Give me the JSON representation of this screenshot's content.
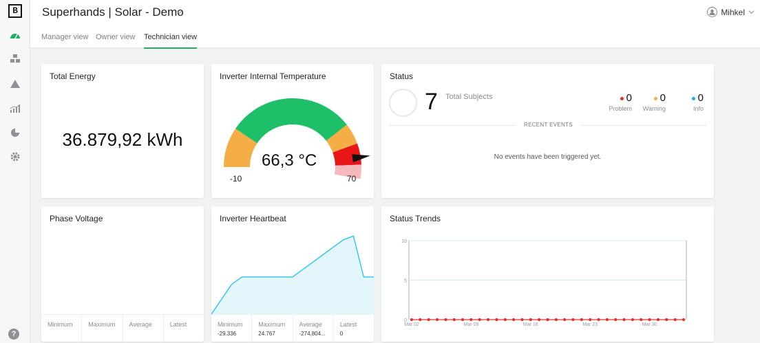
{
  "app": {
    "logo": "B",
    "title": "Superhands | Solar - Demo"
  },
  "user": {
    "name": "Mihkel"
  },
  "nav": {
    "tabs": [
      {
        "label": "Manager view",
        "active": false
      },
      {
        "label": "Owner view",
        "active": false
      },
      {
        "label": "Technician view",
        "active": true
      }
    ],
    "rail_icons": [
      "dashboard-icon",
      "devices-icon",
      "alerts-icon",
      "analytics-icon",
      "reports-icon",
      "settings-icon"
    ],
    "help": "?"
  },
  "colors": {
    "accent": "#1fb05f",
    "gauge_green": "#1fbe68",
    "gauge_orange": "#f5ad45",
    "gauge_red": "#e81616",
    "gauge_pink": "#f6b9bb",
    "problem": "#e82c2c",
    "warning": "#f5ad45",
    "info": "#1fa9e6",
    "heartbeat_fill": "#e3f6fc",
    "heartbeat_line": "#2cc4ea",
    "trend_marker": "#e82c2c"
  },
  "widgets": {
    "total_energy": {
      "title": "Total Energy",
      "value": "36.879,92 kWh"
    },
    "inverter_temp": {
      "title": "Inverter Internal Temperature",
      "value": "66,3 °C",
      "min": "-10",
      "max": "70",
      "reading": 66.3,
      "min_value": -10,
      "max_value": 70
    },
    "status": {
      "title": "Status",
      "total": "7",
      "total_label": "Total Subjects",
      "counts": [
        {
          "label": "Problem",
          "value": "0"
        },
        {
          "label": "Warning",
          "value": "0"
        },
        {
          "label": "Info",
          "value": "0"
        }
      ],
      "recent_events_label": "RECENT EVENTS",
      "no_events_text": "No events have been triggered yet."
    },
    "phase_voltage": {
      "title": "Phase Voltage",
      "stats": [
        {
          "label": "Minimum",
          "value": ""
        },
        {
          "label": "Maximum",
          "value": ""
        },
        {
          "label": "Average",
          "value": ""
        },
        {
          "label": "Latest",
          "value": ""
        }
      ]
    },
    "heartbeat": {
      "title": "Inverter Heartbeat",
      "stats": [
        {
          "label": "Minimum",
          "value": "-29.336"
        },
        {
          "label": "Maximum",
          "value": "24.767"
        },
        {
          "label": "Average",
          "value": "-274,804..."
        },
        {
          "label": "Latest",
          "value": "0"
        }
      ]
    },
    "status_trends": {
      "title": "Status Trends"
    }
  },
  "chart_data": [
    {
      "type": "area",
      "chart": "Inverter Heartbeat",
      "x": [
        0,
        1,
        2,
        3,
        4,
        5,
        6,
        7,
        8,
        9,
        10,
        11,
        12,
        13,
        14,
        15,
        16
      ],
      "y": [
        0,
        4,
        8,
        10,
        10,
        10,
        10,
        10,
        10,
        12,
        14,
        16,
        18,
        20,
        21,
        10,
        10
      ],
      "grid": false
    },
    {
      "type": "line",
      "chart": "Status Trends",
      "ylim": [
        0,
        10
      ],
      "yticks": [
        "0",
        "5",
        "10"
      ],
      "xticks": [
        "Mar 02",
        "Mar 09",
        "Mar 16",
        "Mar 23",
        "Mar 30"
      ],
      "series": [
        {
          "values": [
            0,
            0,
            0,
            0,
            0,
            0,
            0,
            0,
            0,
            0,
            0,
            0,
            0,
            0,
            0,
            0,
            0,
            0,
            0,
            0,
            0,
            0,
            0,
            0,
            0,
            0,
            0,
            0,
            0,
            0,
            0,
            0,
            0
          ]
        }
      ],
      "grid": true
    }
  ]
}
